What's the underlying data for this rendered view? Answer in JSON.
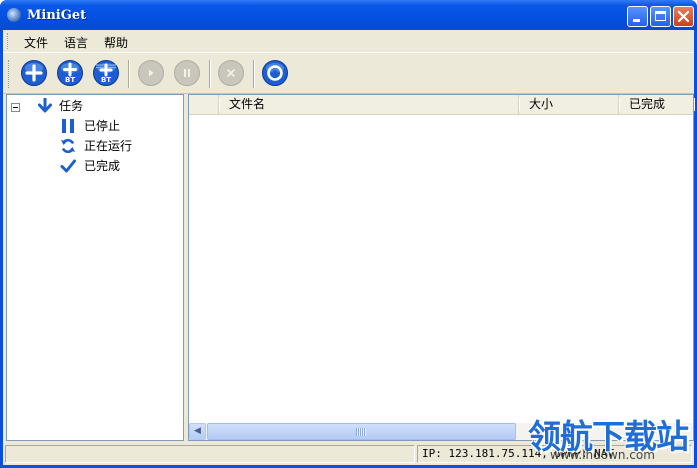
{
  "window": {
    "title": "MiniGet"
  },
  "menu": [
    {
      "label": "文件"
    },
    {
      "label": "语言"
    },
    {
      "label": "帮助"
    }
  ],
  "toolbar": {
    "buttons": [
      {
        "icon": "add-icon",
        "enabled": true
      },
      {
        "icon": "add-bt-icon",
        "badge": "BT",
        "enabled": true
      },
      {
        "icon": "add-bt-batch-icon",
        "badge": "BT",
        "enabled": true
      },
      {
        "icon": "play-icon",
        "enabled": false
      },
      {
        "icon": "pause-icon",
        "enabled": false
      },
      {
        "icon": "delete-icon",
        "enabled": false
      },
      {
        "icon": "settings-icon",
        "enabled": true
      }
    ]
  },
  "tree": {
    "root": {
      "label": "任务",
      "icon": "download-arrow-icon"
    },
    "children": [
      {
        "label": "已停止",
        "icon": "pause-icon"
      },
      {
        "label": "正在运行",
        "icon": "refresh-icon"
      },
      {
        "label": "已完成",
        "icon": "check-icon"
      }
    ]
  },
  "list": {
    "columns": [
      "文件名",
      "大小",
      "已完成"
    ]
  },
  "status": {
    "ip_text": "IP: 123.181.75.114, UPnP: NAT"
  },
  "watermark": {
    "text": "领航下载站",
    "url": "www.lhdown.com"
  },
  "colors": {
    "accent": "#1d5fd1",
    "titlebar": "#0a58e8",
    "face": "#ece9d8"
  }
}
